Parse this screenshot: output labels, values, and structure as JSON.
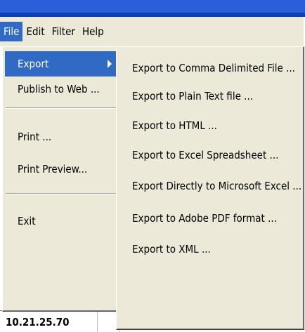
{
  "menubar": {
    "items": [
      "File",
      "Edit",
      "Filter",
      "Help"
    ]
  },
  "file_menu": {
    "items": [
      "Export",
      "Publish to Web ...",
      "Print ...",
      "Print Preview...",
      "Exit"
    ]
  },
  "export_submenu": {
    "items": [
      "Export to Comma Delimited File ...",
      "Export to Plain Text file ...",
      "Export to HTML ...",
      "Export to Excel Spreadsheet ...",
      "Export Directly to Microsoft Excel ...",
      "Export to Adobe PDF format ...",
      "Export to XML ..."
    ]
  },
  "grid": {
    "cell_value": "10.21.25.70"
  },
  "colors": {
    "highlight": "#316ac5",
    "menu_bg": "#ece9d8",
    "titlebar": "#2b5fd9"
  },
  "icons": [
    "submenu-arrow-icon"
  ]
}
